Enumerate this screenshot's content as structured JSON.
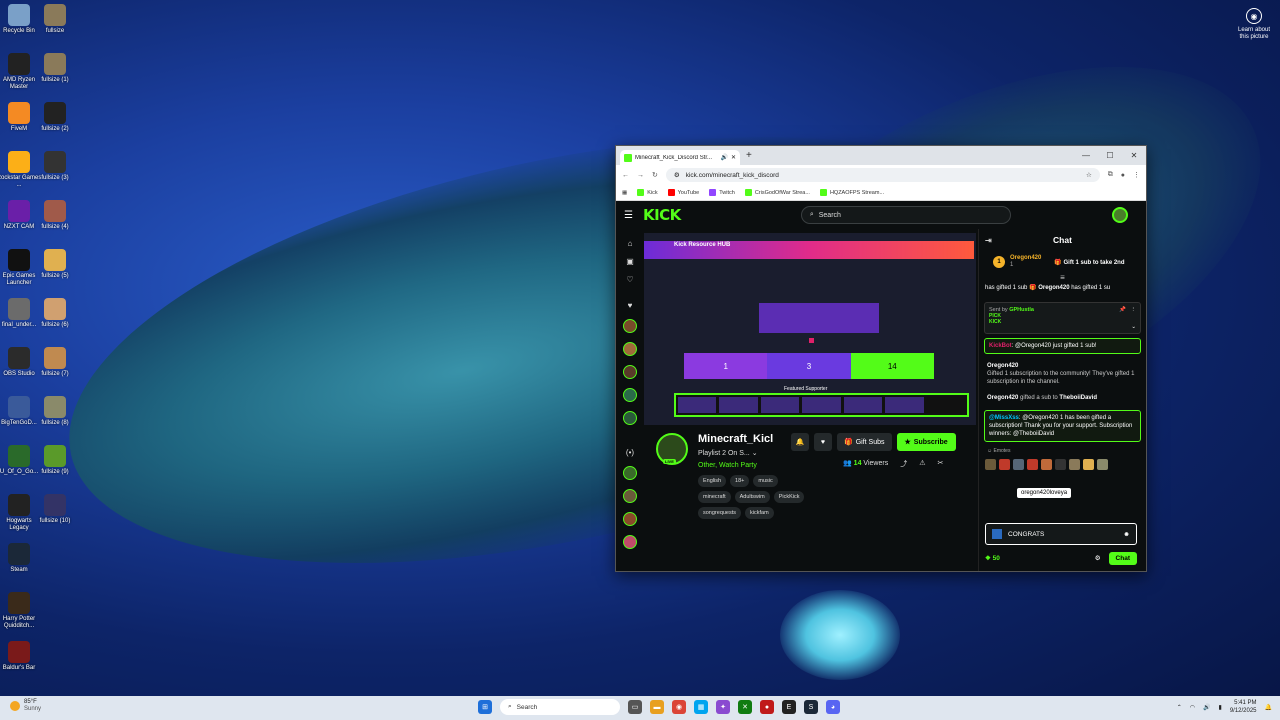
{
  "desktop": {
    "icons_left": [
      {
        "label": "Recycle Bin",
        "icon": "recycle-bin-icon",
        "color": "#7aa0c8"
      },
      {
        "label": "AMD Ryzen Master",
        "icon": "amd-icon",
        "color": "#222222"
      },
      {
        "label": "FiveM",
        "icon": "fivem-icon",
        "color": "#f48a23"
      },
      {
        "label": "Rockstar Games ...",
        "icon": "rockstar-icon",
        "color": "#fcaf17"
      },
      {
        "label": "NZXT CAM",
        "icon": "nzxt-icon",
        "color": "#6a1fa8"
      },
      {
        "label": "Epic Games Launcher",
        "icon": "epic-icon",
        "color": "#111111"
      },
      {
        "label": "final_under...",
        "icon": "file-icon",
        "color": "#6b6b6b"
      },
      {
        "label": "OBS Studio",
        "icon": "obs-icon",
        "color": "#2b2b2b"
      },
      {
        "label": "BigTenGoD...",
        "icon": "file-icon",
        "color": "#3a5a9a"
      },
      {
        "label": "U_Of_O_Go...",
        "icon": "file-icon",
        "color": "#2a6a2a"
      },
      {
        "label": "Hogwarts Legacy",
        "icon": "hogwarts-icon",
        "color": "#222222"
      },
      {
        "label": "Steam",
        "icon": "steam-icon",
        "color": "#1b2838"
      },
      {
        "label": "Harry Potter Quidditch...",
        "icon": "hp-icon",
        "color": "#3a2a1a"
      },
      {
        "label": "Baldur's Bar",
        "icon": "game-icon",
        "color": "#7a1a1a"
      }
    ],
    "icons_right": [
      {
        "label": "fullsize",
        "color": "#8a7a5a"
      },
      {
        "label": "fullsize (1)",
        "color": "#8a7a5a"
      },
      {
        "label": "fullsize (2)",
        "color": "#222222"
      },
      {
        "label": "fullsize (3)",
        "color": "#333333"
      },
      {
        "label": "fullsize (4)",
        "color": "#a05a4a"
      },
      {
        "label": "fullsize (5)",
        "color": "#e0b050"
      },
      {
        "label": "fullsize (6)",
        "color": "#d0a070"
      },
      {
        "label": "fullsize (7)",
        "color": "#c08a50"
      },
      {
        "label": "fullsize (8)",
        "color": "#8a8a6a"
      },
      {
        "label": "fullsize (9)",
        "color": "#5a9a2a"
      },
      {
        "label": "fullsize (10)",
        "color": "#333366"
      }
    ],
    "learn_label": "Learn about this picture"
  },
  "browser": {
    "tab_title": "Minecraft_Kick_Discord Str...",
    "url": "kick.com/minecraft_kick_discord",
    "bookmarks": [
      {
        "label": "Kick",
        "color": "#53fc18"
      },
      {
        "label": "YouTube",
        "color": "#ff0000"
      },
      {
        "label": "Twitch",
        "color": "#9146ff"
      },
      {
        "label": "CrisGodOfWar Strea...",
        "color": "#53fc18"
      },
      {
        "label": "HQZAOFPS Stream...",
        "color": "#53fc18"
      }
    ]
  },
  "kick": {
    "logo": "KICK",
    "search_placeholder": "Search",
    "player": {
      "banner_title": "Kick Resource HUB",
      "counts": [
        "1",
        "3",
        "14"
      ],
      "featured_label": "Featured Supporter"
    },
    "channel": {
      "name": "Minecraft_Kicl",
      "live": "LIVE",
      "subtitle": "Playlist 2 On S...",
      "category": "Other, Watch Party",
      "viewers": "14",
      "viewers_label": "Viewers",
      "gift_label": "Gift Subs",
      "subscribe_label": "Subscribe",
      "tags": [
        "English",
        "18+",
        "music",
        "minecraft",
        "Adultswim",
        "PickKick",
        "songrequests",
        "kickfam"
      ]
    },
    "chat": {
      "title": "Chat",
      "top_gifter": {
        "rank": "1",
        "name": "Oregon420",
        "count": "1",
        "cta": "Gift 1 sub to take 2nd"
      },
      "ticker_a": "has gifted 1 sub",
      "ticker_name": "Oregon420",
      "ticker_b": "has gifted 1 su",
      "pinned_sentby": "Sent by",
      "pinned_user": "GPHustla",
      "pinned_text": "PICK KICK",
      "messages": [
        {
          "user": "KickBot",
          "text": ": @Oregon420 just gifted 1 sub!"
        },
        {
          "user": "Oregon420",
          "text": "Gifted 1 subscription to the community! They've gifted 1 subscription in the channel."
        },
        {
          "user": "Oregon420",
          "text": "gifted a sub to",
          "target": "TheboiiDavid"
        }
      ],
      "highlight": {
        "user": "@MissXss",
        "text": ": @Oregon420 1 has been gifted a subscription! Thank you for your support. Subscription winners: @TheboiiDavid"
      },
      "emotes_label": "Emotes",
      "tooltip": "oregon420loveya",
      "input_value": "CONGRATS",
      "points": "50",
      "send_label": "Chat"
    }
  },
  "taskbar": {
    "weather_temp": "85°F",
    "weather_cond": "Sunny",
    "search_placeholder": "Search",
    "time": "5:41 PM",
    "date": "9/12/2025"
  },
  "colors": {
    "kick_green": "#53fc18"
  }
}
